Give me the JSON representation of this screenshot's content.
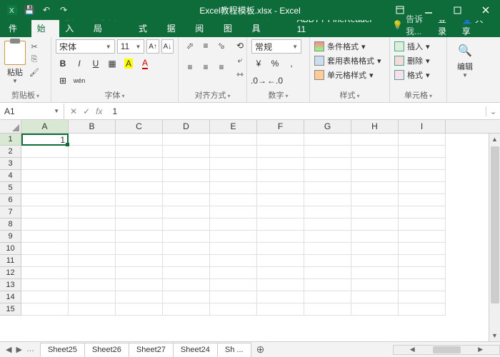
{
  "title": "Excel教程模板.xlsx - Excel",
  "tabs": {
    "file": "文件",
    "home": "开始",
    "insert": "插入",
    "layout": "页面布局",
    "formulas": "公式",
    "data": "数据",
    "review": "审阅",
    "view": "视图",
    "dev": "开发工具",
    "abbyy": "ABBYY FineReader 11"
  },
  "tellme": "告诉我...",
  "login": "登录",
  "share": "共享",
  "groups": {
    "clipboard": "剪贴板",
    "font": "字体",
    "align": "对齐方式",
    "number": "数字",
    "styles": "样式",
    "cells": "单元格",
    "edit": "编辑"
  },
  "paste": "粘贴",
  "font": {
    "name": "宋体",
    "size": "11"
  },
  "number_format": "常规",
  "styles": {
    "cond": "条件格式",
    "tbl": "套用表格格式",
    "cell": "单元格样式"
  },
  "cells": {
    "ins": "插入",
    "del": "删除",
    "fmt": "格式"
  },
  "namebox": "A1",
  "formula": "1",
  "cols": [
    "A",
    "B",
    "C",
    "D",
    "E",
    "F",
    "G",
    "H",
    "I"
  ],
  "rows": [
    "1",
    "2",
    "3",
    "4",
    "5",
    "6",
    "7",
    "8",
    "9",
    "10",
    "11",
    "12",
    "13",
    "14",
    "15"
  ],
  "cell_a1": "1",
  "sheets": [
    "Sheet25",
    "Sheet26",
    "Sheet27",
    "Sheet24",
    "Sh ..."
  ]
}
